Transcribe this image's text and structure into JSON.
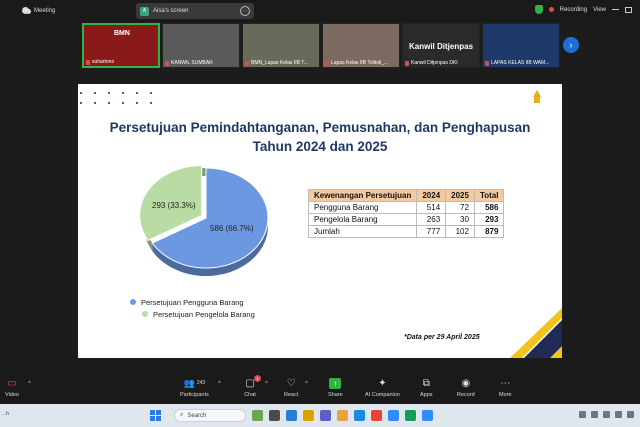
{
  "window": {
    "meeting_label": "Meeting",
    "screen_share": {
      "avatar_letter": "A",
      "label": "Aisa's screen",
      "more": "⋯"
    },
    "recording_label": "Recording",
    "view_label": "View"
  },
  "participants_strip": [
    {
      "name": "suhartono",
      "big_label": "",
      "badge_text": "BMN",
      "bg": "#8a1a1a"
    },
    {
      "name": "KANWIL SUMBAR",
      "big_label": "",
      "badge_text": "",
      "bg": "#5a5a5a"
    },
    {
      "name": "BMN_Lapas Kelas IIB T...",
      "big_label": "",
      "badge_text": "",
      "bg": "#6a6a5a"
    },
    {
      "name": "Lapas Kelas IIB Tolitoli_...",
      "big_label": "",
      "badge_text": "",
      "bg": "#7a6a60"
    },
    {
      "name": "Kanwil Ditjenpas DKI",
      "big_label": "Kanwil   Ditjenpas",
      "badge_text": "",
      "bg": "#2a2a2a"
    },
    {
      "name": "LAPAS KELAS IIB WAM...",
      "big_label": "",
      "badge_text": "",
      "bg": "#1f3a6a"
    }
  ],
  "slide": {
    "title_line1": "Persetujuan Pemindahtanganan, Pemusnahan, dan Penghapusan",
    "title_line2": "Tahun 2024 dan 2025",
    "pie_labels": {
      "big": "586 (66.7%)",
      "small": "293 (33.3%)"
    },
    "legend": [
      {
        "label": "Persetujuan Pengguna Barang",
        "color": "#6b98e0"
      },
      {
        "label": "Persetujuan Pengelola Barang",
        "color": "#b9dca4"
      }
    ],
    "table": {
      "headers": [
        "Kewenangan Persetujuan",
        "2024",
        "2025",
        "Total"
      ],
      "rows": [
        [
          "Pengguna Barang",
          "514",
          "72",
          "586"
        ],
        [
          "Pengelola Barang",
          "263",
          "30",
          "293"
        ],
        [
          "Jumlah",
          "777",
          "102",
          "879"
        ]
      ]
    },
    "note": "*Data per 29 April 2025"
  },
  "chart_data": {
    "type": "pie",
    "categories": [
      "Persetujuan Pengguna Barang",
      "Persetujuan Pengelola Barang"
    ],
    "values": [
      586,
      293
    ],
    "percentages": [
      66.7,
      33.3
    ],
    "colors": [
      "#6b98e0",
      "#b9dca4"
    ],
    "legend_position": "bottom-left"
  },
  "toolbar": {
    "video": "Video",
    "participants": "Participants",
    "participants_count": "243",
    "chat": "Chat",
    "chat_badge": "1",
    "react": "React",
    "share": "Share",
    "ai": "AI Companion",
    "apps": "Apps",
    "record": "Record",
    "more": "More"
  },
  "taskbar": {
    "left_text": "...h",
    "search_placeholder": "Search"
  }
}
